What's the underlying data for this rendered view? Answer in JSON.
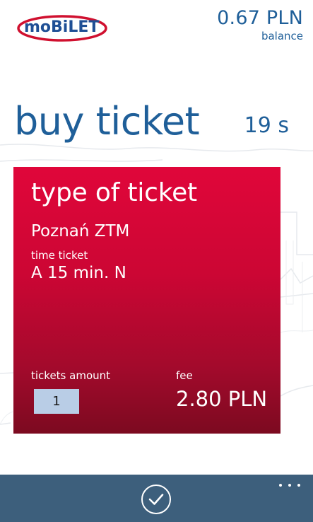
{
  "header": {
    "logo_text": "moBiLET",
    "balance_amount": "0.67 PLN",
    "balance_label": "balance"
  },
  "page": {
    "title": "buy ticket",
    "timer": "19 s"
  },
  "ticket_card": {
    "title": "type of ticket",
    "carrier": "Poznań ZTM",
    "kind_label": "time ticket",
    "ticket_name": "A 15 min. N",
    "amount_label": "tickets amount",
    "amount_value": "1",
    "fee_label": "fee",
    "fee_value": "2.80 PLN"
  },
  "app_bar": {
    "confirm_icon": "checkmark-icon",
    "more_icon": "ellipsis-icon"
  },
  "colors": {
    "accent": "#1f5f99",
    "card_top": "#e0063a",
    "card_bottom": "#7c0a20",
    "app_bar": "#3d5f7c",
    "input_bg": "#b9cde6"
  }
}
